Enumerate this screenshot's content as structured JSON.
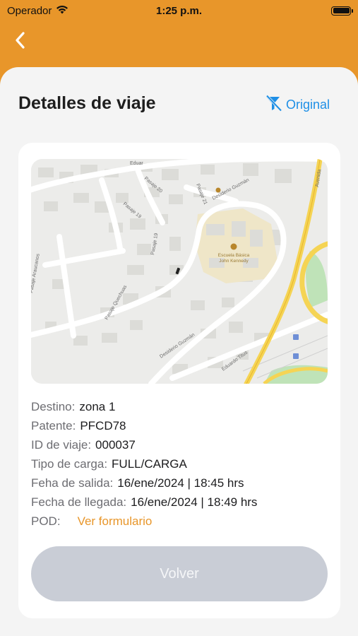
{
  "status_bar": {
    "carrier": "Operador",
    "time": "1:25 p.m.",
    "icons": [
      "wifi-icon",
      "battery-icon"
    ]
  },
  "nav": {
    "back_icon": "chevron-left-icon"
  },
  "header": {
    "title": "Detalles de viaje",
    "original_label": "Original",
    "original_icon": "filter-off-icon"
  },
  "map": {
    "labels": {
      "eduardo_top": "Eduar",
      "pasaje20": "Pasaje 20",
      "pasaje21": "Pasaje 21",
      "desiderio1": "Desiderio Guzmán",
      "pasaje19a": "Pasaje 19",
      "pasaje19b": "Pasaje 19",
      "quechuas": "Pasaje Quechuas",
      "araucanos": "Pasaje Araucanos",
      "desiderio2": "Desiderio Guzmán",
      "eduardo_titus": "Eduardo Titus",
      "avenida": "Avenida",
      "school_line1": "Escuela Básica",
      "school_line2": "John Kennedy"
    }
  },
  "details": {
    "destino_label": "Destino:",
    "destino_value": "zona 1",
    "patente_label": "Patente:",
    "patente_value": "PFCD78",
    "id_label": "ID de viaje:",
    "id_value": "000037",
    "tipo_label": "Tipo de carga:",
    "tipo_value": "FULL/CARGA",
    "salida_label": "Feha de salida:",
    "salida_value": "16/ene/2024 | 18:45 hrs",
    "llegada_label": "Fecha de llegada:",
    "llegada_value": "16/ene/2024 | 18:49 hrs",
    "pod_label": "POD:",
    "pod_link": "Ver formulario"
  },
  "actions": {
    "volver_label": "Volver"
  },
  "colors": {
    "accent": "#e8962a",
    "link_blue": "#1e8fe6",
    "button_disabled": "#c9cdd6"
  }
}
